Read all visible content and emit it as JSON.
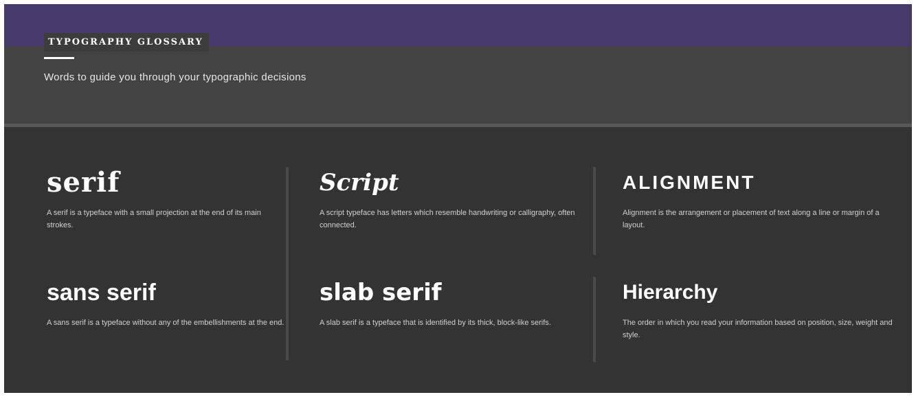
{
  "header": {
    "title": "TYPOGRAPHY GLOSSARY",
    "subtitle": "Words to guide you through your typographic decisions"
  },
  "colors": {
    "band": "#463a6b",
    "header_bg": "#434343",
    "body_bg": "#333333",
    "text": "#ffffff"
  },
  "terms": [
    {
      "name": "serif",
      "description": "A serif is a typeface with a small projection at the end of its main strokes."
    },
    {
      "name": "Script",
      "description": "A script typeface has letters which resemble handwriting or calligraphy, often connected."
    },
    {
      "name": "ALIGNMENT",
      "description": "Alignment is the arrangement or placement of text along a line or margin of a layout."
    },
    {
      "name": "sans serif",
      "description": "A sans serif is a typeface without any of the embellishments at the end."
    },
    {
      "name": "slab serif",
      "description": "A slab serif is a typeface that is identified by its thick, block-like serifs."
    },
    {
      "name_strong": "Hier",
      "name_rest": "archy",
      "description": "The order in which you read your information based on position, size, weight and style."
    }
  ]
}
